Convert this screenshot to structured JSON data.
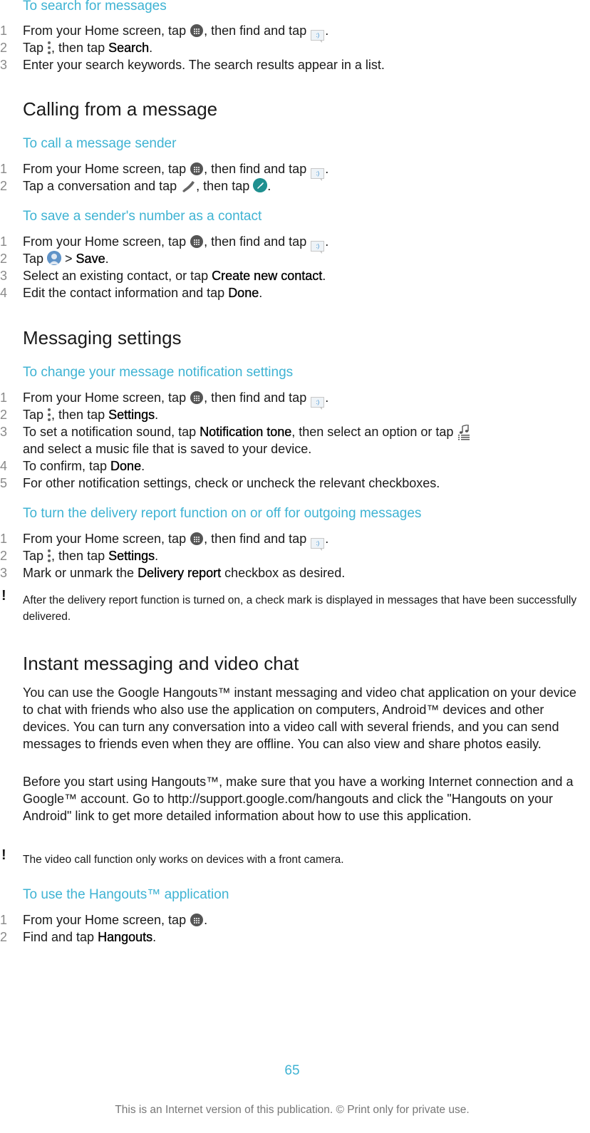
{
  "sections": {
    "search": {
      "subhead": "To search for messages",
      "steps": [
        {
          "num": "1",
          "a": "From your Home screen, tap ",
          "b": ", then find and tap ",
          "c": "."
        },
        {
          "num": "2",
          "a": "Tap ",
          "b": ", then tap ",
          "bold": "Search",
          "c": "."
        },
        {
          "num": "3",
          "a": "Enter your search keywords. The search results appear in a list."
        }
      ]
    },
    "calling": {
      "heading": "Calling from a message",
      "call_sender": {
        "subhead": "To call a message sender",
        "steps": [
          {
            "num": "1",
            "a": "From your Home screen, tap ",
            "b": ", then find and tap ",
            "c": "."
          },
          {
            "num": "2",
            "a": "Tap a conversation and tap ",
            "b": ", then tap ",
            "c": "."
          }
        ]
      },
      "save_contact": {
        "subhead": "To save a sender's number as a contact",
        "steps": [
          {
            "num": "1",
            "a": "From your Home screen, tap ",
            "b": ", then find and tap ",
            "c": "."
          },
          {
            "num": "2",
            "a": "Tap ",
            "b": " > ",
            "bold": "Save",
            "c": "."
          },
          {
            "num": "3",
            "a": "Select an existing contact, or tap ",
            "bold": "Create new contact",
            "c": "."
          },
          {
            "num": "4",
            "a": "Edit the contact information and tap ",
            "bold": "Done",
            "c": "."
          }
        ]
      }
    },
    "settings": {
      "heading": "Messaging settings",
      "notification": {
        "subhead": "To change your message notification settings",
        "steps": [
          {
            "num": "1",
            "a": "From your Home screen, tap ",
            "b": ", then find and tap ",
            "c": "."
          },
          {
            "num": "2",
            "a": "Tap ",
            "b": ", then tap ",
            "bold": "Settings",
            "c": "."
          },
          {
            "num": "3",
            "a": "To set a notification sound, tap ",
            "bold": "Notification tone",
            "b": ", then select an option or tap ",
            "line2": "and select a music file that is saved to your device."
          },
          {
            "num": "4",
            "a": "To confirm, tap ",
            "bold": "Done",
            "c": "."
          },
          {
            "num": "5",
            "a": "For other notification settings, check or uncheck the relevant checkboxes."
          }
        ]
      },
      "delivery": {
        "subhead": "To turn the delivery report function on or off for outgoing messages",
        "steps": [
          {
            "num": "1",
            "a": "From your Home screen, tap ",
            "b": ", then find and tap ",
            "c": "."
          },
          {
            "num": "2",
            "a": "Tap ",
            "b": ", then tap ",
            "bold": "Settings",
            "c": "."
          },
          {
            "num": "3",
            "a": "Mark or unmark the ",
            "bold": "Delivery report",
            "c": " checkbox as desired."
          }
        ],
        "note": "After the delivery report function is turned on, a check mark is displayed in messages that have been successfully delivered."
      }
    },
    "hangouts": {
      "heading": "Instant messaging and video chat",
      "para1": "You can use the Google Hangouts™ instant messaging and video chat application on your device to chat with friends who also use the application on computers, Android™ devices and other devices. You can turn any conversation into a video call with several friends, and you can send messages to friends even when they are offline. You can also view and share photos easily.",
      "para2": "Before you start using Hangouts™, make sure that you have a working Internet connection and a Google™ account. Go to http://support.google.com/hangouts and click the \"Hangouts on your Android\" link to get more detailed information about how to use this application.",
      "note": "The video call function only works on devices with a front camera.",
      "use": {
        "subhead": "To use the Hangouts™ application",
        "steps": [
          {
            "num": "1",
            "a": "From your Home screen, tap ",
            "c": "."
          },
          {
            "num": "2",
            "a": "Find and tap ",
            "bold": "Hangouts",
            "c": "."
          }
        ]
      }
    }
  },
  "icons": {
    "note": "!",
    "msg": ":)"
  },
  "footer": {
    "page_number": "65",
    "notice": "This is an Internet version of this publication. © Print only for private use."
  },
  "colors": {
    "accent": "#3fb3d3",
    "text": "#1a1a1a",
    "step_number": "#8a8a8a",
    "call_button": "#1f8f8f"
  }
}
